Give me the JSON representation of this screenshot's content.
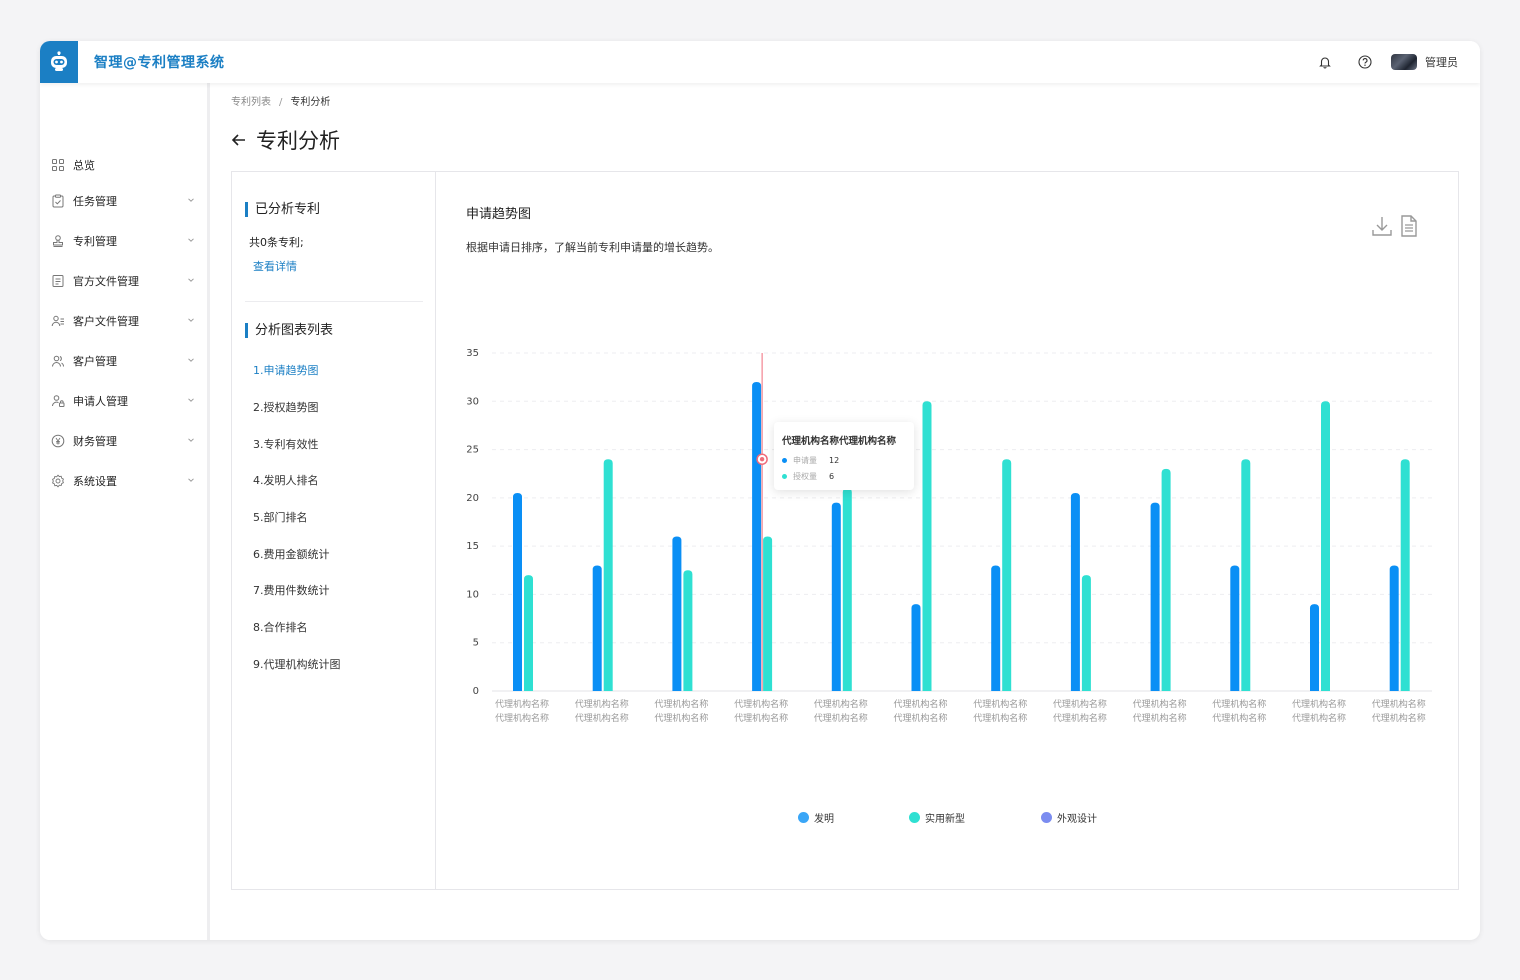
{
  "app": {
    "title": "智理@专利管理系统",
    "user_name": "管理员"
  },
  "sidebar": {
    "items": [
      {
        "label": "总览",
        "icon": "grid-icon",
        "has_children": false
      },
      {
        "label": "任务管理",
        "icon": "clipboard-check-icon",
        "has_children": true
      },
      {
        "label": "专利管理",
        "icon": "stamp-icon",
        "has_children": true
      },
      {
        "label": "官方文件管理",
        "icon": "document-icon",
        "has_children": true
      },
      {
        "label": "客户文件管理",
        "icon": "user-doc-icon",
        "has_children": true
      },
      {
        "label": "客户管理",
        "icon": "users-icon",
        "has_children": true
      },
      {
        "label": "申请人管理",
        "icon": "user-lock-icon",
        "has_children": true
      },
      {
        "label": "财务管理",
        "icon": "yen-coin-icon",
        "has_children": true
      },
      {
        "label": "系统设置",
        "icon": "settings-icon",
        "has_children": true
      }
    ]
  },
  "breadcrumb": {
    "parent": "专利列表",
    "separator": "/",
    "current": "专利分析"
  },
  "page": {
    "title": "专利分析"
  },
  "left_panel": {
    "analyzed_title": "已分析专利",
    "count_text": "共0条专利;",
    "detail_link": "查看详情",
    "list_title": "分析图表列表",
    "charts": [
      {
        "label": "1.申请趋势图",
        "active": true
      },
      {
        "label": "2.授权趋势图",
        "active": false
      },
      {
        "label": "3.专利有效性",
        "active": false
      },
      {
        "label": "4.发明人排名",
        "active": false
      },
      {
        "label": "5.部门排名",
        "active": false
      },
      {
        "label": "6.费用金额统计",
        "active": false
      },
      {
        "label": "7.费用件数统计",
        "active": false
      },
      {
        "label": "8.合作排名",
        "active": false
      },
      {
        "label": "9.代理机构统计图",
        "active": false
      }
    ]
  },
  "chart_panel": {
    "title": "申请趋势图",
    "description": "根据申请日排序，了解当前专利申请量的增长趋势。",
    "tools": [
      "download-icon",
      "file-text-icon"
    ]
  },
  "tooltip": {
    "title": "代理机构名称代理机构名称",
    "rows": [
      {
        "label": "申请量",
        "value": "12",
        "color": "#0a8ff5"
      },
      {
        "label": "授权量",
        "value": "6",
        "color": "#2fe0d2"
      }
    ]
  },
  "chart_data": {
    "type": "bar",
    "categories": [
      "代理机构名称\n代理机构名称",
      "代理机构名称\n代理机构名称",
      "代理机构名称\n代理机构名称",
      "代理机构名称\n代理机构名称",
      "代理机构名称\n代理机构名称",
      "代理机构名称\n代理机构名称",
      "代理机构名称\n代理机构名称",
      "代理机构名称\n代理机构名称",
      "代理机构名称\n代理机构名称",
      "代理机构名称\n代理机构名称",
      "代理机构名称\n代理机构名称",
      "代理机构名称\n代理机构名称"
    ],
    "series": [
      {
        "name": "发明",
        "color": "#0a8ff5",
        "values": [
          20.5,
          13,
          16,
          32,
          19.5,
          9,
          13,
          20.5,
          19.5,
          13,
          9,
          13
        ]
      },
      {
        "name": "实用新型",
        "color": "#2fe0d2",
        "values": [
          12,
          24,
          12.5,
          16,
          21,
          30,
          24,
          12,
          23,
          24,
          30,
          24
        ]
      },
      {
        "name": "外观设计",
        "color": "#7b8cf0",
        "values": []
      }
    ],
    "yticks": [
      0,
      5,
      10,
      15,
      20,
      25,
      30,
      35
    ],
    "ylim": [
      0,
      35
    ],
    "grid": true,
    "legend_position": "bottom-center",
    "highlight_index": 3
  }
}
